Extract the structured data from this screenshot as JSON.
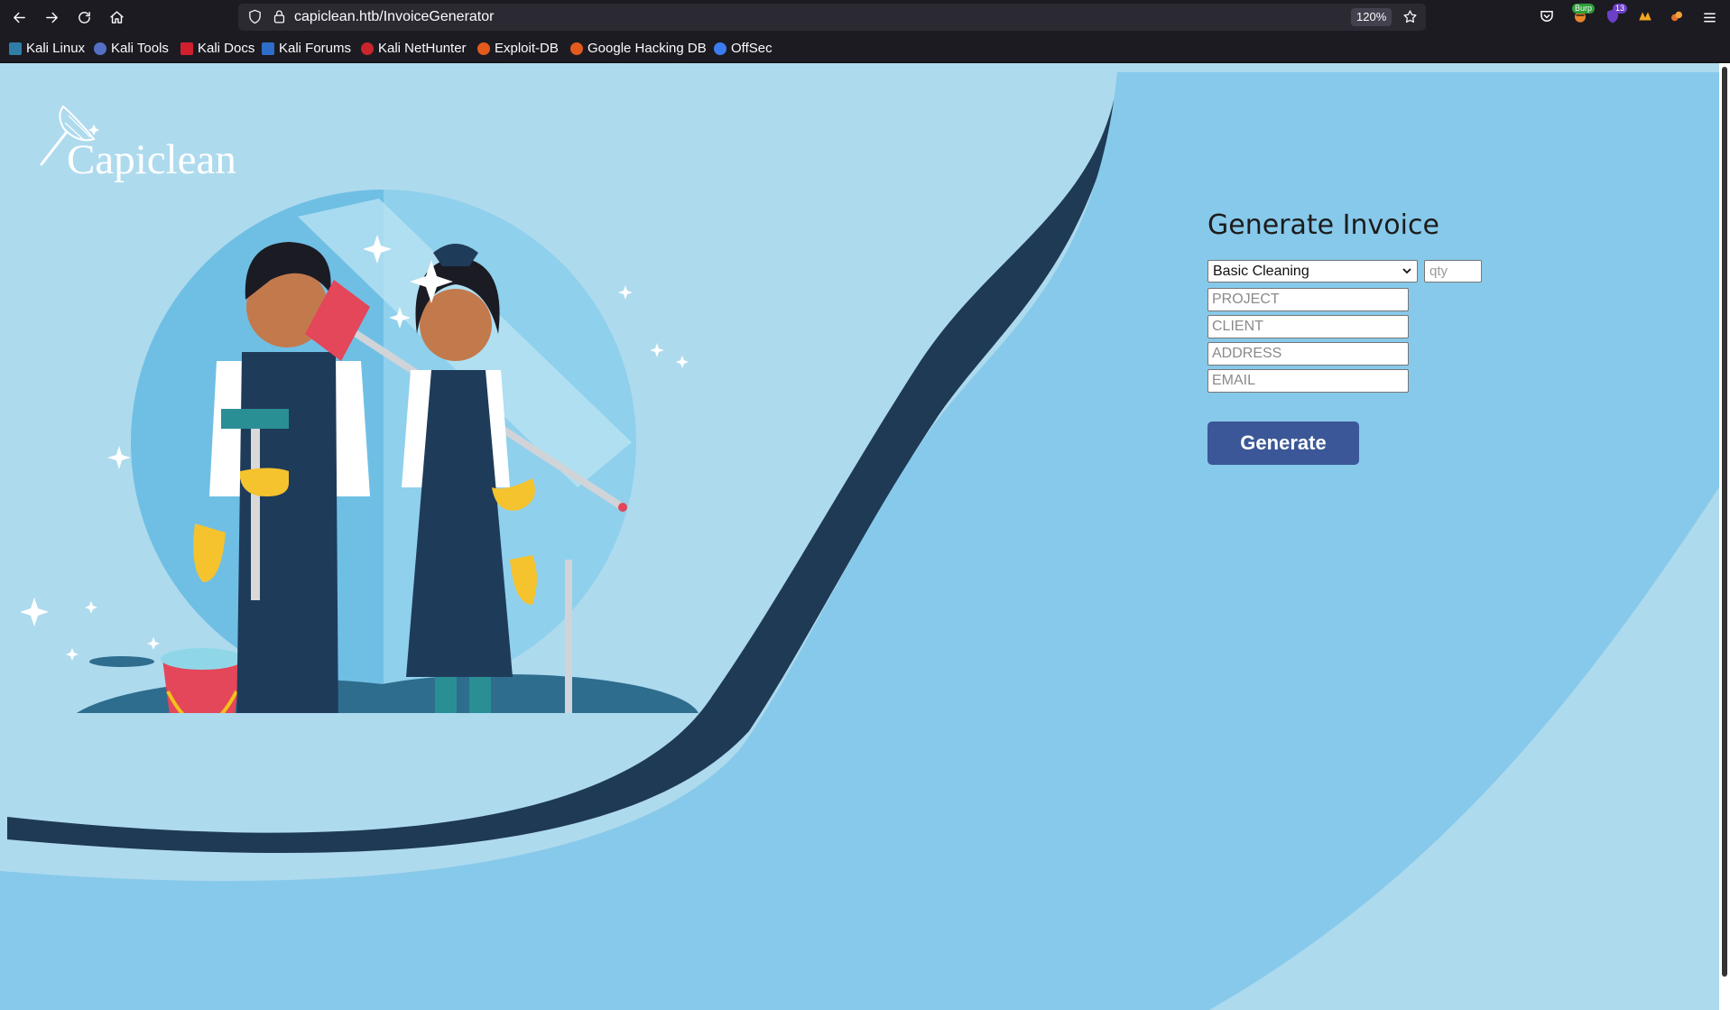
{
  "browser": {
    "url": "capiclean.htb/InvoiceGenerator",
    "zoom": "120%",
    "extensions": [
      {
        "name": "pocket-icon",
        "badge": ""
      },
      {
        "name": "burp-icon",
        "badge": "Burp"
      },
      {
        "name": "ublock-icon",
        "badge": "13"
      },
      {
        "name": "wappalyzer-icon",
        "badge": ""
      },
      {
        "name": "foxyproxy-icon",
        "badge": ""
      }
    ],
    "bookmarks": [
      {
        "label": "Kali Linux",
        "color": "#2f7ea8"
      },
      {
        "label": "Kali Tools",
        "color": "#5470c6"
      },
      {
        "label": "Kali Docs",
        "color": "#d0202e"
      },
      {
        "label": "Kali Forums",
        "color": "#2d6ec9"
      },
      {
        "label": "Kali NetHunter",
        "color": "#c8262c"
      },
      {
        "label": "Exploit-DB",
        "color": "#e25a1c"
      },
      {
        "label": "Google Hacking DB",
        "color": "#e25a1c"
      },
      {
        "label": "OffSec",
        "color": "#3d7cf0"
      }
    ]
  },
  "page": {
    "logo_text": "Capiclean",
    "form": {
      "title": "Generate Invoice",
      "service_selected": "Basic Cleaning",
      "qty_placeholder": "qty",
      "project_placeholder": "PROJECT",
      "client_placeholder": "CLIENT",
      "address_placeholder": "ADDRESS",
      "email_placeholder": "EMAIL",
      "generate_label": "Generate"
    },
    "colors": {
      "background": "#aedaee",
      "wave": "#87c9ea",
      "button": "#3b5797"
    }
  }
}
